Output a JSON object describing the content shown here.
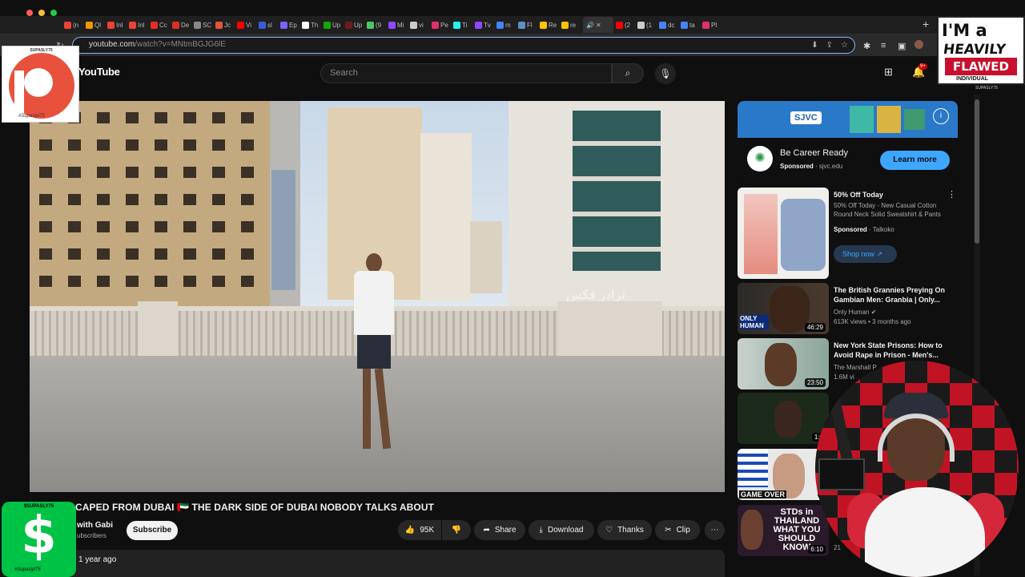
{
  "browser": {
    "url_host": "youtube.com",
    "url_path": "/watch?v=MNtmBGJG6lE",
    "tabs": [
      {
        "label": "(n",
        "color": "#ea4335"
      },
      {
        "label": "Ql",
        "color": "#f29900"
      },
      {
        "label": "Inl",
        "color": "#ea4335"
      },
      {
        "label": "Inl",
        "color": "#ea4335"
      },
      {
        "label": "Cc",
        "color": "#e52d27"
      },
      {
        "label": "De",
        "color": "#d93025"
      },
      {
        "label": "SC",
        "color": "#888888"
      },
      {
        "label": "Jc",
        "color": "#e5533d"
      },
      {
        "label": "Vi",
        "color": "#ff0000"
      },
      {
        "label": "sl",
        "color": "#3b5bdb"
      },
      {
        "label": "Ep",
        "color": "#7b61ff"
      },
      {
        "label": "Th",
        "color": "#ffffff"
      },
      {
        "label": "Up",
        "color": "#14a800"
      },
      {
        "label": "Up",
        "color": "#6a1b1b"
      },
      {
        "label": "(9",
        "color": "#4cc764"
      },
      {
        "label": "Mi",
        "color": "#9146ff"
      },
      {
        "label": "vi",
        "color": "#cccccc"
      },
      {
        "label": "Pe",
        "color": "#e1306c"
      },
      {
        "label": "Ti",
        "color": "#25f4ee"
      },
      {
        "label": "Tv",
        "color": "#9146ff"
      },
      {
        "label": "m",
        "color": "#4285f4"
      },
      {
        "label": "Fl",
        "color": "#5f8fc8"
      },
      {
        "label": "Re",
        "color": "#ffc400"
      },
      {
        "label": "re",
        "color": "#ffc400"
      }
    ],
    "active_tab_label": "",
    "tabs_after": [
      {
        "label": "(2",
        "color": "#ff0000"
      },
      {
        "label": "(1",
        "color": "#cccccc"
      },
      {
        "label": "dc",
        "color": "#4285f4"
      },
      {
        "label": "ta",
        "color": "#4285f4"
      },
      {
        "label": "Pl",
        "color": "#e1306c"
      }
    ]
  },
  "youtube": {
    "logo_text": "YouTube",
    "search_placeholder": "Search",
    "notification_badge": "9+",
    "video": {
      "title": "CAPED FROM DUBAI 🇦🇪 THE DARK SIDE OF DUBAI NOBODY TALKS ABOUT",
      "overlay_sign_text": "ترادر فكس",
      "channel_name": "with Gabi",
      "subscribers": "ubscribers",
      "subscribe_label": "Subscribe",
      "likes": "95K",
      "share_label": "Share",
      "download_label": "Download",
      "thanks_label": "Thanks",
      "clip_label": "Clip",
      "uploaded": "1 year ago"
    },
    "ad": {
      "brand": "SJVC",
      "title": "Be Career Ready",
      "sponsored": "Sponsored",
      "domain": "sjvc.edu",
      "cta": "Learn more"
    },
    "recommendations": [
      {
        "title": "50% Off Today",
        "meta1": "50% Off Today - New Casual Cotton Round Neck Solid Sweatshirt & Pants",
        "sponsored": "Sponsored",
        "advertiser": "Talkoko",
        "cta": "Shop now",
        "duration": ""
      },
      {
        "title": "The British Grannies Preying On Gambian Men: Granbia | Only...",
        "channel": "Only Human",
        "stats": "613K views • 3 months ago",
        "duration": "46:29",
        "thumb_text": "ONLY HUMAN"
      },
      {
        "title": "New York State Prisons: How to Avoid Rape in Prison - Men's...",
        "channel": "The Marshall P",
        "stats": "1.6M vi",
        "duration": "23:50"
      },
      {
        "title": "",
        "channel": "",
        "stats": "",
        "duration": "1:0"
      },
      {
        "title": "",
        "channel": "",
        "stats": "",
        "duration": "4",
        "thumb_text": "GAME OVER"
      },
      {
        "title": "",
        "channel": "",
        "stats": "21",
        "duration": "6:10",
        "thumb_text": "STDs in THAILAND WHAT YOU SHOULD KNOW"
      }
    ]
  },
  "overlays": {
    "patreon_label": "SUPASLY75",
    "patreon_handle": "#Supaslyl75",
    "cashapp_label": "$SUPASLY75",
    "cashapp_sign": "$",
    "cashapp_handle": "#Supaslyl75",
    "flawed_line1": "I'M a",
    "flawed_line2": "HEAVILY",
    "flawed_line3": "FLAWED",
    "flawed_line4": "INDIVIDUAL",
    "flawed_tag": "SUPASLY75"
  },
  "colors": {
    "accent": "#3ea6ff",
    "youtube_red": "#ff0000",
    "patreon": "#e8513c",
    "cashapp": "#00c244"
  }
}
